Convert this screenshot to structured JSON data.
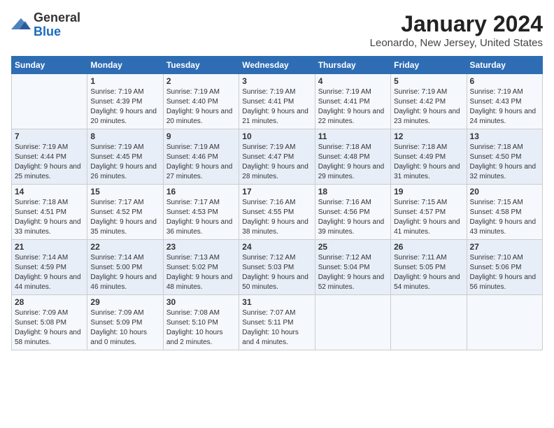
{
  "logo": {
    "general": "General",
    "blue": "Blue"
  },
  "title": {
    "month": "January 2024",
    "location": "Leonardo, New Jersey, United States"
  },
  "weekdays": [
    "Sunday",
    "Monday",
    "Tuesday",
    "Wednesday",
    "Thursday",
    "Friday",
    "Saturday"
  ],
  "weeks": [
    [
      {
        "day": "",
        "sunrise": "",
        "sunset": "",
        "daylight": ""
      },
      {
        "day": "1",
        "sunrise": "Sunrise: 7:19 AM",
        "sunset": "Sunset: 4:39 PM",
        "daylight": "Daylight: 9 hours and 20 minutes."
      },
      {
        "day": "2",
        "sunrise": "Sunrise: 7:19 AM",
        "sunset": "Sunset: 4:40 PM",
        "daylight": "Daylight: 9 hours and 20 minutes."
      },
      {
        "day": "3",
        "sunrise": "Sunrise: 7:19 AM",
        "sunset": "Sunset: 4:41 PM",
        "daylight": "Daylight: 9 hours and 21 minutes."
      },
      {
        "day": "4",
        "sunrise": "Sunrise: 7:19 AM",
        "sunset": "Sunset: 4:41 PM",
        "daylight": "Daylight: 9 hours and 22 minutes."
      },
      {
        "day": "5",
        "sunrise": "Sunrise: 7:19 AM",
        "sunset": "Sunset: 4:42 PM",
        "daylight": "Daylight: 9 hours and 23 minutes."
      },
      {
        "day": "6",
        "sunrise": "Sunrise: 7:19 AM",
        "sunset": "Sunset: 4:43 PM",
        "daylight": "Daylight: 9 hours and 24 minutes."
      }
    ],
    [
      {
        "day": "7",
        "sunrise": "Sunrise: 7:19 AM",
        "sunset": "Sunset: 4:44 PM",
        "daylight": "Daylight: 9 hours and 25 minutes."
      },
      {
        "day": "8",
        "sunrise": "Sunrise: 7:19 AM",
        "sunset": "Sunset: 4:45 PM",
        "daylight": "Daylight: 9 hours and 26 minutes."
      },
      {
        "day": "9",
        "sunrise": "Sunrise: 7:19 AM",
        "sunset": "Sunset: 4:46 PM",
        "daylight": "Daylight: 9 hours and 27 minutes."
      },
      {
        "day": "10",
        "sunrise": "Sunrise: 7:19 AM",
        "sunset": "Sunset: 4:47 PM",
        "daylight": "Daylight: 9 hours and 28 minutes."
      },
      {
        "day": "11",
        "sunrise": "Sunrise: 7:18 AM",
        "sunset": "Sunset: 4:48 PM",
        "daylight": "Daylight: 9 hours and 29 minutes."
      },
      {
        "day": "12",
        "sunrise": "Sunrise: 7:18 AM",
        "sunset": "Sunset: 4:49 PM",
        "daylight": "Daylight: 9 hours and 31 minutes."
      },
      {
        "day": "13",
        "sunrise": "Sunrise: 7:18 AM",
        "sunset": "Sunset: 4:50 PM",
        "daylight": "Daylight: 9 hours and 32 minutes."
      }
    ],
    [
      {
        "day": "14",
        "sunrise": "Sunrise: 7:18 AM",
        "sunset": "Sunset: 4:51 PM",
        "daylight": "Daylight: 9 hours and 33 minutes."
      },
      {
        "day": "15",
        "sunrise": "Sunrise: 7:17 AM",
        "sunset": "Sunset: 4:52 PM",
        "daylight": "Daylight: 9 hours and 35 minutes."
      },
      {
        "day": "16",
        "sunrise": "Sunrise: 7:17 AM",
        "sunset": "Sunset: 4:53 PM",
        "daylight": "Daylight: 9 hours and 36 minutes."
      },
      {
        "day": "17",
        "sunrise": "Sunrise: 7:16 AM",
        "sunset": "Sunset: 4:55 PM",
        "daylight": "Daylight: 9 hours and 38 minutes."
      },
      {
        "day": "18",
        "sunrise": "Sunrise: 7:16 AM",
        "sunset": "Sunset: 4:56 PM",
        "daylight": "Daylight: 9 hours and 39 minutes."
      },
      {
        "day": "19",
        "sunrise": "Sunrise: 7:15 AM",
        "sunset": "Sunset: 4:57 PM",
        "daylight": "Daylight: 9 hours and 41 minutes."
      },
      {
        "day": "20",
        "sunrise": "Sunrise: 7:15 AM",
        "sunset": "Sunset: 4:58 PM",
        "daylight": "Daylight: 9 hours and 43 minutes."
      }
    ],
    [
      {
        "day": "21",
        "sunrise": "Sunrise: 7:14 AM",
        "sunset": "Sunset: 4:59 PM",
        "daylight": "Daylight: 9 hours and 44 minutes."
      },
      {
        "day": "22",
        "sunrise": "Sunrise: 7:14 AM",
        "sunset": "Sunset: 5:00 PM",
        "daylight": "Daylight: 9 hours and 46 minutes."
      },
      {
        "day": "23",
        "sunrise": "Sunrise: 7:13 AM",
        "sunset": "Sunset: 5:02 PM",
        "daylight": "Daylight: 9 hours and 48 minutes."
      },
      {
        "day": "24",
        "sunrise": "Sunrise: 7:12 AM",
        "sunset": "Sunset: 5:03 PM",
        "daylight": "Daylight: 9 hours and 50 minutes."
      },
      {
        "day": "25",
        "sunrise": "Sunrise: 7:12 AM",
        "sunset": "Sunset: 5:04 PM",
        "daylight": "Daylight: 9 hours and 52 minutes."
      },
      {
        "day": "26",
        "sunrise": "Sunrise: 7:11 AM",
        "sunset": "Sunset: 5:05 PM",
        "daylight": "Daylight: 9 hours and 54 minutes."
      },
      {
        "day": "27",
        "sunrise": "Sunrise: 7:10 AM",
        "sunset": "Sunset: 5:06 PM",
        "daylight": "Daylight: 9 hours and 56 minutes."
      }
    ],
    [
      {
        "day": "28",
        "sunrise": "Sunrise: 7:09 AM",
        "sunset": "Sunset: 5:08 PM",
        "daylight": "Daylight: 9 hours and 58 minutes."
      },
      {
        "day": "29",
        "sunrise": "Sunrise: 7:09 AM",
        "sunset": "Sunset: 5:09 PM",
        "daylight": "Daylight: 10 hours and 0 minutes."
      },
      {
        "day": "30",
        "sunrise": "Sunrise: 7:08 AM",
        "sunset": "Sunset: 5:10 PM",
        "daylight": "Daylight: 10 hours and 2 minutes."
      },
      {
        "day": "31",
        "sunrise": "Sunrise: 7:07 AM",
        "sunset": "Sunset: 5:11 PM",
        "daylight": "Daylight: 10 hours and 4 minutes."
      },
      {
        "day": "",
        "sunrise": "",
        "sunset": "",
        "daylight": ""
      },
      {
        "day": "",
        "sunrise": "",
        "sunset": "",
        "daylight": ""
      },
      {
        "day": "",
        "sunrise": "",
        "sunset": "",
        "daylight": ""
      }
    ]
  ]
}
